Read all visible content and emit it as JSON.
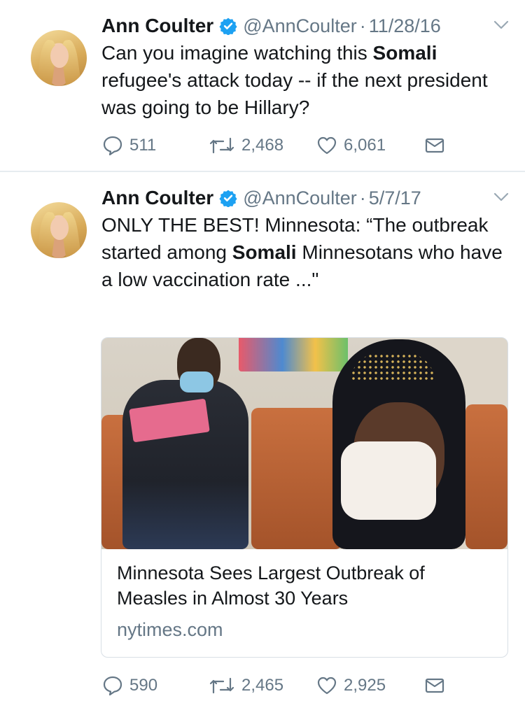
{
  "tweets": [
    {
      "author_name": "Ann Coulter",
      "handle": "@AnnCoulter",
      "separator": "·",
      "date": "11/28/16",
      "text_parts": [
        "Can you imagine watching this ",
        "Somali",
        " refugee's attack today -- if the next president was going to be Hillary?"
      ],
      "replies": "511",
      "retweets": "2,468",
      "likes": "6,061"
    },
    {
      "author_name": "Ann Coulter",
      "handle": "@AnnCoulter",
      "separator": "·",
      "date": "5/7/17",
      "text_parts": [
        "ONLY THE BEST!  Minnesota: “The outbreak started among ",
        "Somali",
        " Minnesotans who have a low vaccination rate ...\""
      ],
      "card": {
        "title": "Minnesota Sees Largest Outbreak of Measles in Almost 30 Years",
        "domain": "nytimes.com"
      },
      "replies": "590",
      "retweets": "2,465",
      "likes": "2,925"
    }
  ],
  "colors": {
    "text": "#14171a",
    "muted": "#657786",
    "verified": "#1da1f2",
    "divider": "#e6ecf0"
  },
  "icons": {
    "reply": "reply-icon",
    "retweet": "retweet-icon",
    "like": "heart-icon",
    "dm": "envelope-icon",
    "menu": "chevron-down-icon",
    "verified": "verified-badge-icon"
  }
}
